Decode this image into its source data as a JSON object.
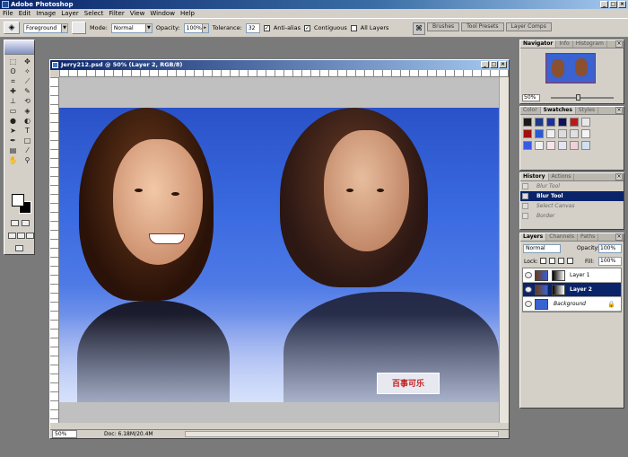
{
  "app": {
    "title": "Adobe Photoshop"
  },
  "menu": [
    "File",
    "Edit",
    "Image",
    "Layer",
    "Select",
    "Filter",
    "View",
    "Window",
    "Help"
  ],
  "options": {
    "preset": "Foreground",
    "mode_label": "Mode:",
    "mode_value": "Normal",
    "opacity_label": "Opacity:",
    "opacity_value": "100%",
    "tolerance_label": "Tolerance:",
    "tolerance_value": "32",
    "antialias_label": "Anti-alias",
    "contiguous_label": "Contiguous",
    "all_layers_label": "All Layers"
  },
  "well_tabs": [
    "Brushes",
    "Tool Presets",
    "Layer Comps"
  ],
  "document": {
    "title": "Jerry212.psd @ 50% (Layer 2, RGB/8)",
    "zoom": "50%",
    "doc_info": "Doc: 6.18M/20.4M",
    "logo_text": "百事可乐"
  },
  "navigator": {
    "tabs": [
      "Navigator",
      "Info",
      "Histogram"
    ],
    "zoom": "50%"
  },
  "swatches": {
    "tabs": [
      "Color",
      "Swatches",
      "Styles"
    ],
    "colors": [
      "#1a1a1a",
      "#1c3a8a",
      "#1e2e9a",
      "#10105a",
      "#c01818",
      "#e8e8e8",
      "#a01010",
      "#2a5ad0",
      "#f0f0f0",
      "#dcdcdc",
      "#e0e0e0",
      "#f4f4f4",
      "#3a5ae0",
      "#f2f2f2",
      "#f8e4e8",
      "#e4e4f0",
      "#f0d0d8",
      "#d0e0f0"
    ]
  },
  "history": {
    "tabs": [
      "History",
      "Actions"
    ],
    "items": [
      {
        "label": "Blur Tool",
        "state": "normal"
      },
      {
        "label": "Blur Tool",
        "state": "active"
      },
      {
        "label": "Select Canvas",
        "state": "dim"
      },
      {
        "label": "Border",
        "state": "dim"
      }
    ]
  },
  "layers": {
    "tabs": [
      "Layers",
      "Channels",
      "Paths"
    ],
    "blend_mode": "Normal",
    "opacity_label": "Opacity:",
    "opacity_value": "100%",
    "lock_label": "Lock:",
    "fill_label": "Fill:",
    "fill_value": "100%",
    "items": [
      {
        "name": "Layer 1",
        "active": false
      },
      {
        "name": "Layer 2",
        "active": true
      },
      {
        "name": "Background",
        "active": false
      }
    ]
  }
}
